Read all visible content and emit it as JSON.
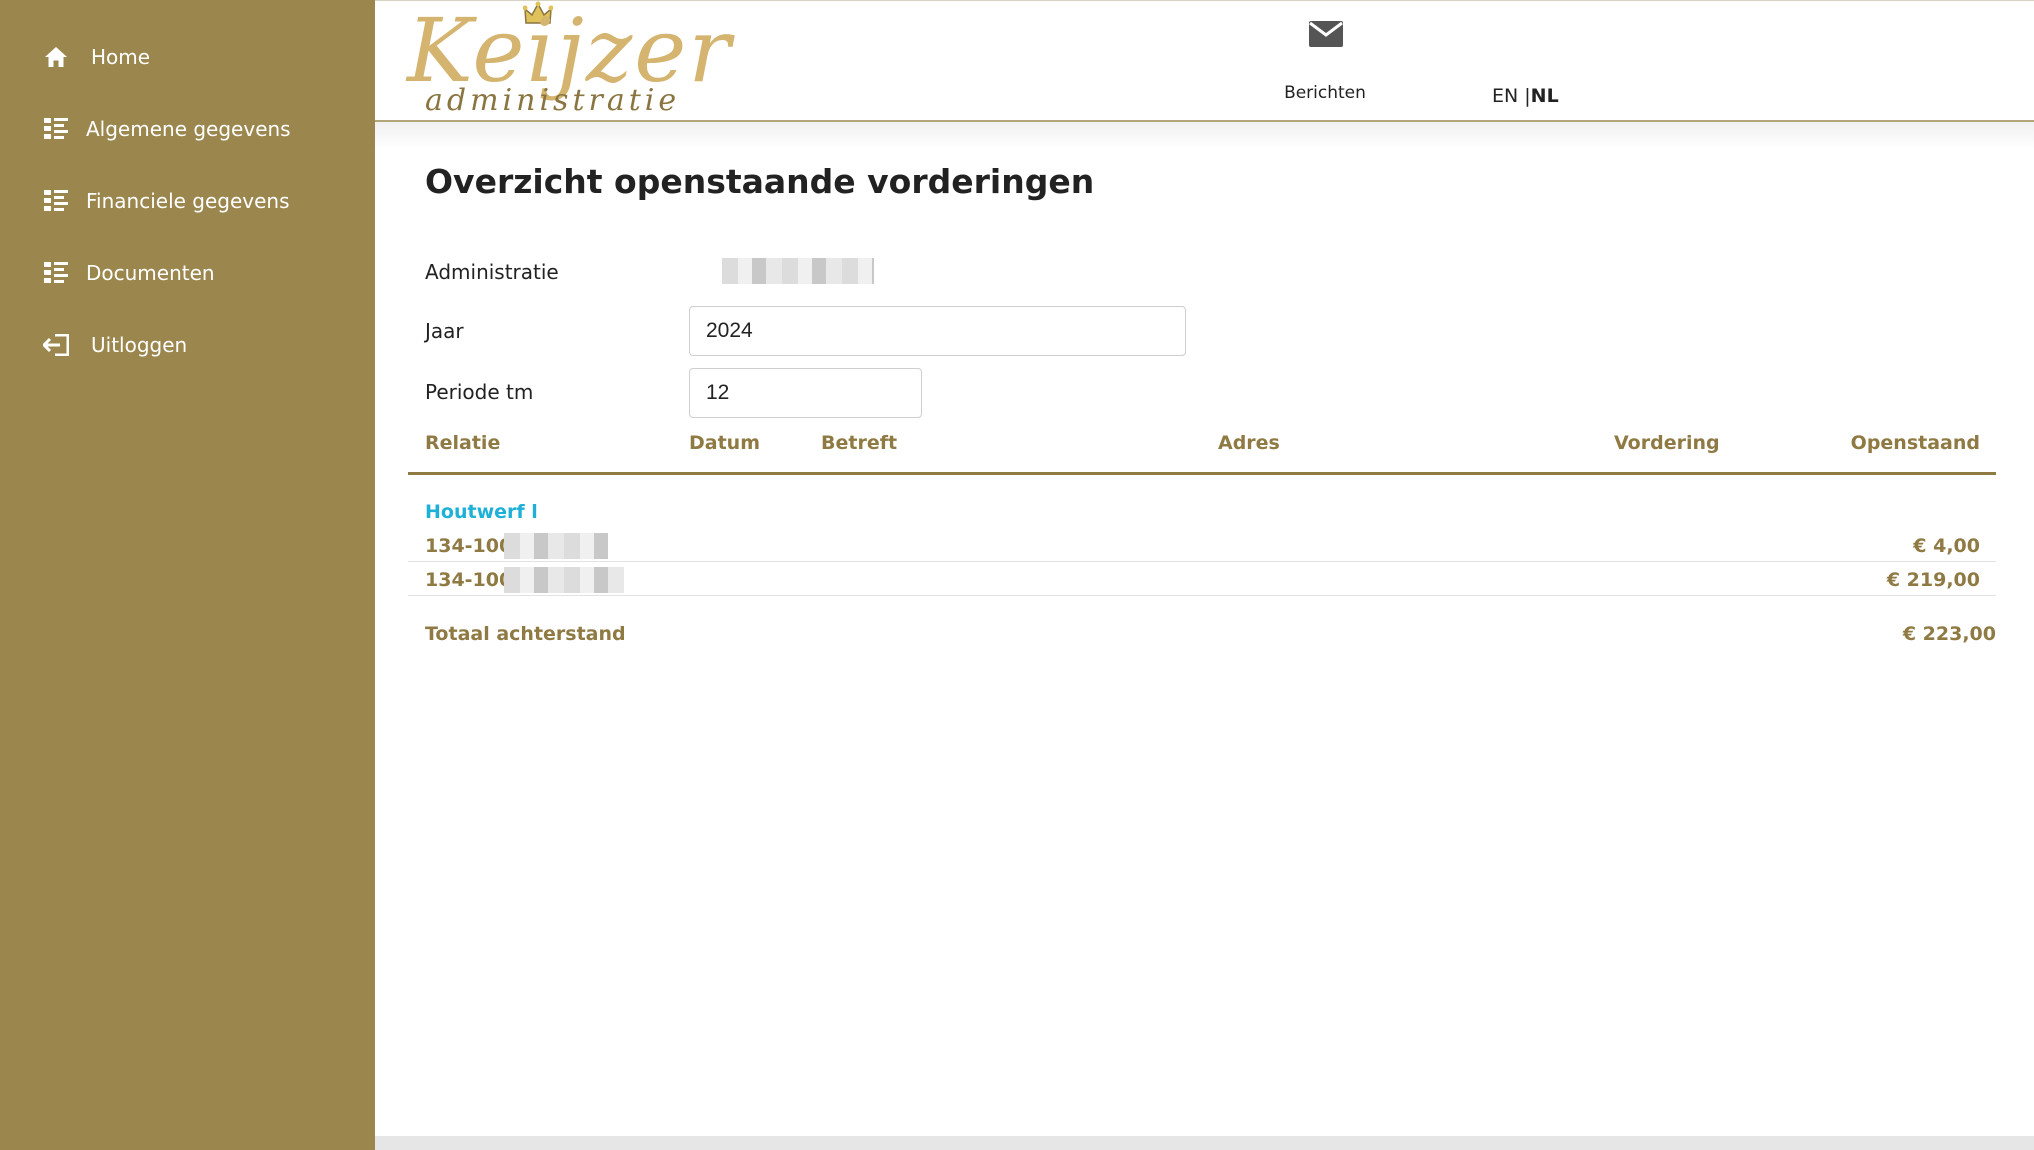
{
  "sidebar": {
    "items": [
      {
        "label": "Home",
        "icon": "home-icon"
      },
      {
        "label": "Algemene gegevens",
        "icon": "list-icon"
      },
      {
        "label": "Financiele gegevens",
        "icon": "list-icon"
      },
      {
        "label": "Documenten",
        "icon": "list-icon"
      },
      {
        "label": "Uitloggen",
        "icon": "logout-icon"
      }
    ]
  },
  "header": {
    "logo_word": "Keijzer",
    "logo_sub": "administratie",
    "messages_label": "Berichten",
    "lang_en": "EN",
    "lang_sep": " |",
    "lang_nl": "NL"
  },
  "main": {
    "title": "Overzicht openstaande vorderingen",
    "administratie_label": "Administratie",
    "jaar_label": "Jaar",
    "jaar_value": "2024",
    "periode_label": "Periode tm",
    "periode_value": "12",
    "columns": [
      "Relatie",
      "Datum",
      "Betreft",
      "Adres",
      "Vordering",
      "Openstaand"
    ],
    "group": "Houtwerf l",
    "rows": [
      {
        "code": "134-100",
        "openstaand": "€ 4,00"
      },
      {
        "code": "134-100",
        "openstaand": "€ 219,00"
      }
    ],
    "total_label": "Totaal achterstand",
    "total_value": "€ 223,00"
  },
  "colors": {
    "sidebar": "#9b874e",
    "accent": "#8f7a43",
    "link": "#1fb0d8"
  }
}
